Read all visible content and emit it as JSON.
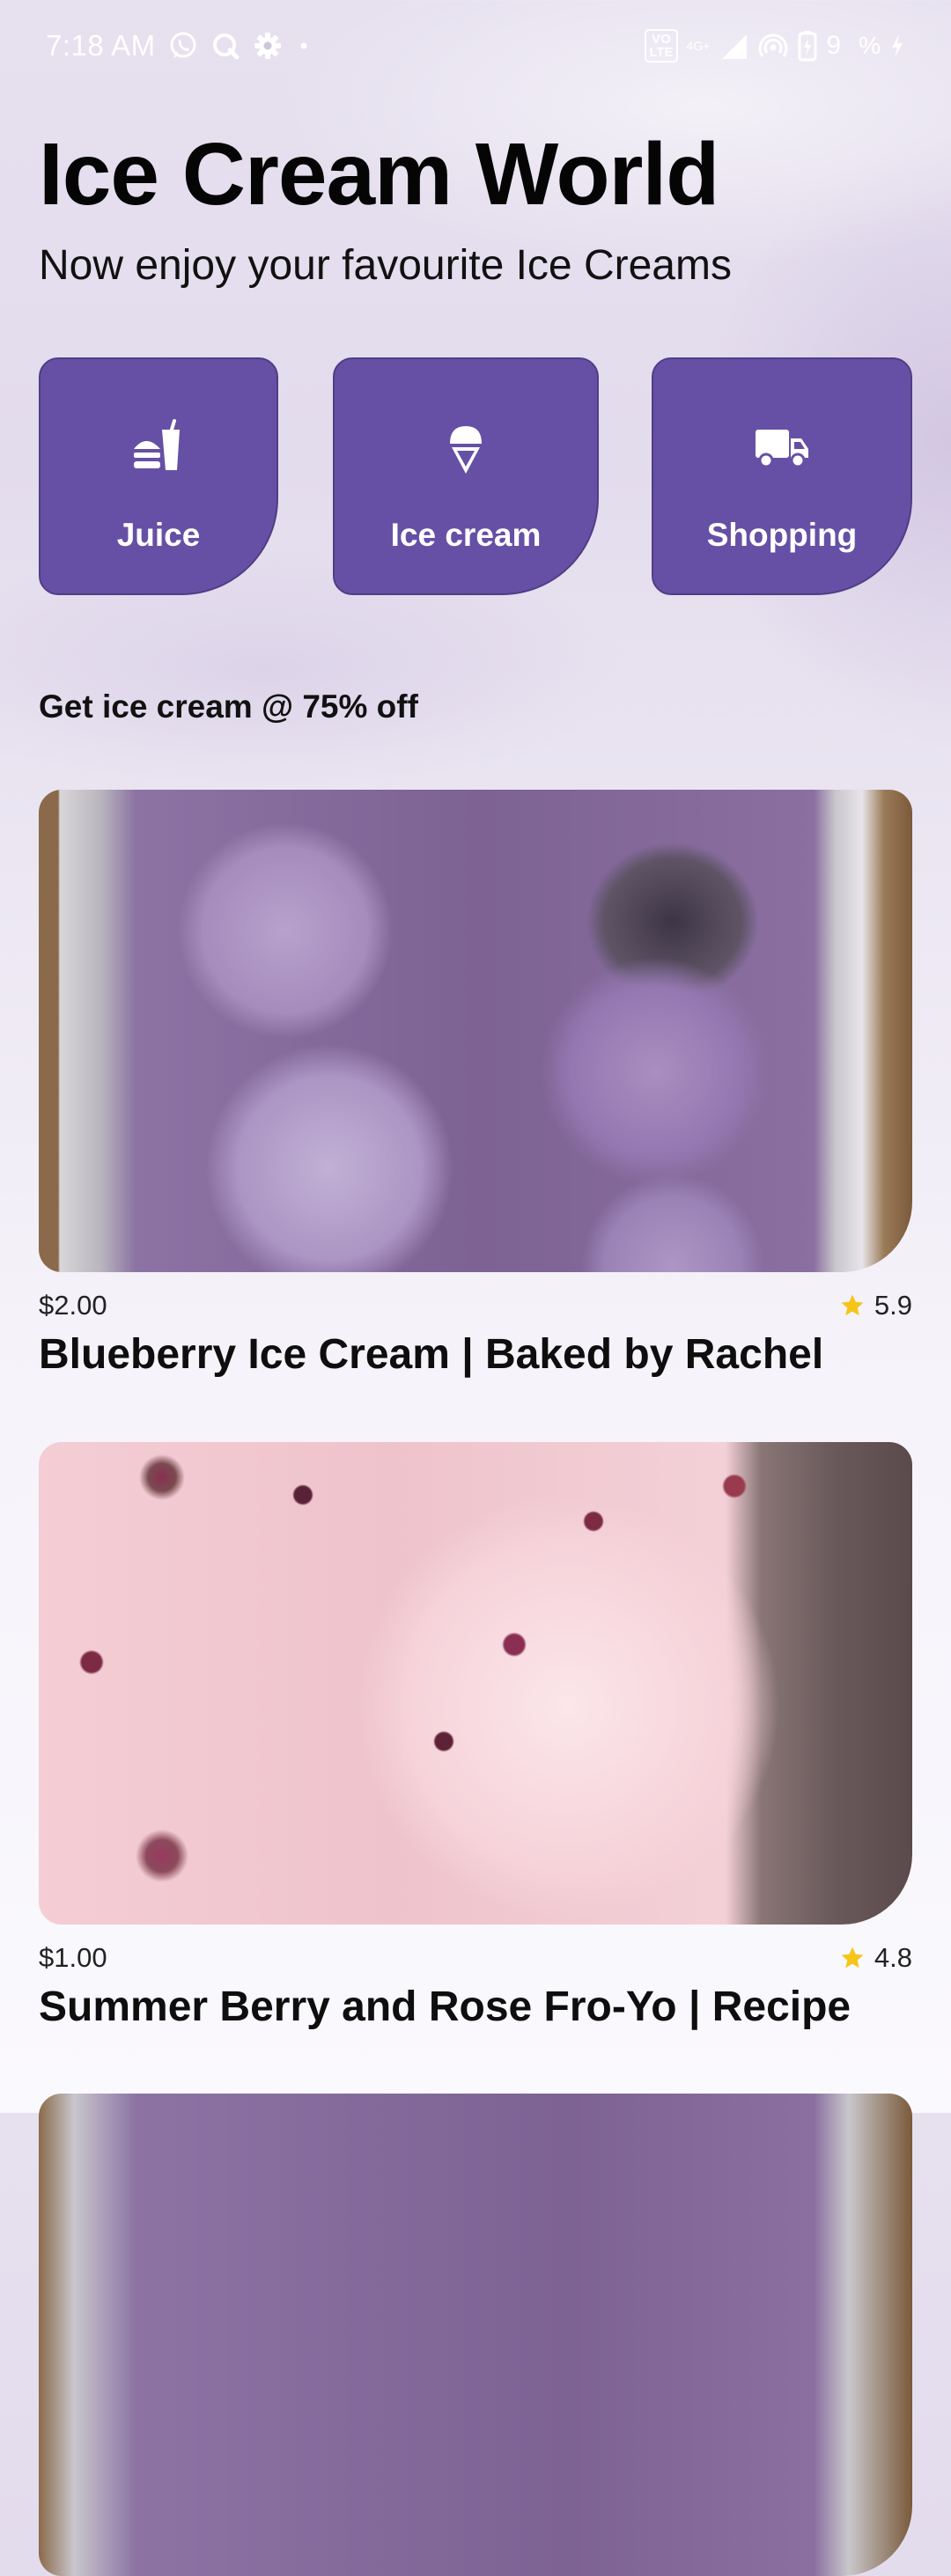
{
  "status_bar": {
    "time": "7:18 AM",
    "network": "4G+",
    "volte_top": "VO",
    "volte_bottom": "LTE",
    "battery": "9",
    "battery_suffix": "%"
  },
  "header": {
    "title": "Ice Cream World",
    "subtitle": "Now enjoy your favourite Ice Creams"
  },
  "categories": [
    {
      "label": "Juice",
      "icon": "fastfood-icon"
    },
    {
      "label": "Ice cream",
      "icon": "ice-cream-icon"
    },
    {
      "label": "Shopping",
      "icon": "delivery-truck-icon"
    }
  ],
  "promo": {
    "heading": "Get ice cream @ 75% off"
  },
  "products": [
    {
      "price": "$2.00",
      "rating": "5.9",
      "name": "Blueberry Ice Cream | Baked by Rachel"
    },
    {
      "price": "$1.00",
      "rating": "4.8",
      "name": "Summer Berry and Rose Fro-Yo | Recipe"
    }
  ],
  "colors": {
    "tile": "#6650a5",
    "star": "#f5c518",
    "background": "#e6e0ef"
  }
}
